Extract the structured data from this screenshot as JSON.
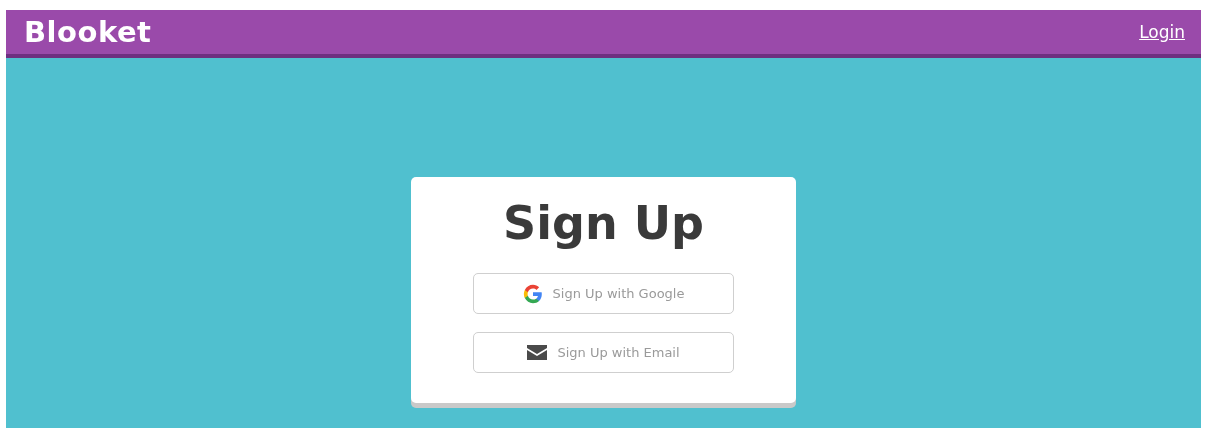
{
  "header": {
    "logo": "Blooket",
    "login_link": "Login"
  },
  "card": {
    "title": "Sign Up",
    "buttons": [
      {
        "kind": "google",
        "label": "Sign Up with Google"
      },
      {
        "kind": "email",
        "label": "Sign Up with Email"
      }
    ]
  }
}
